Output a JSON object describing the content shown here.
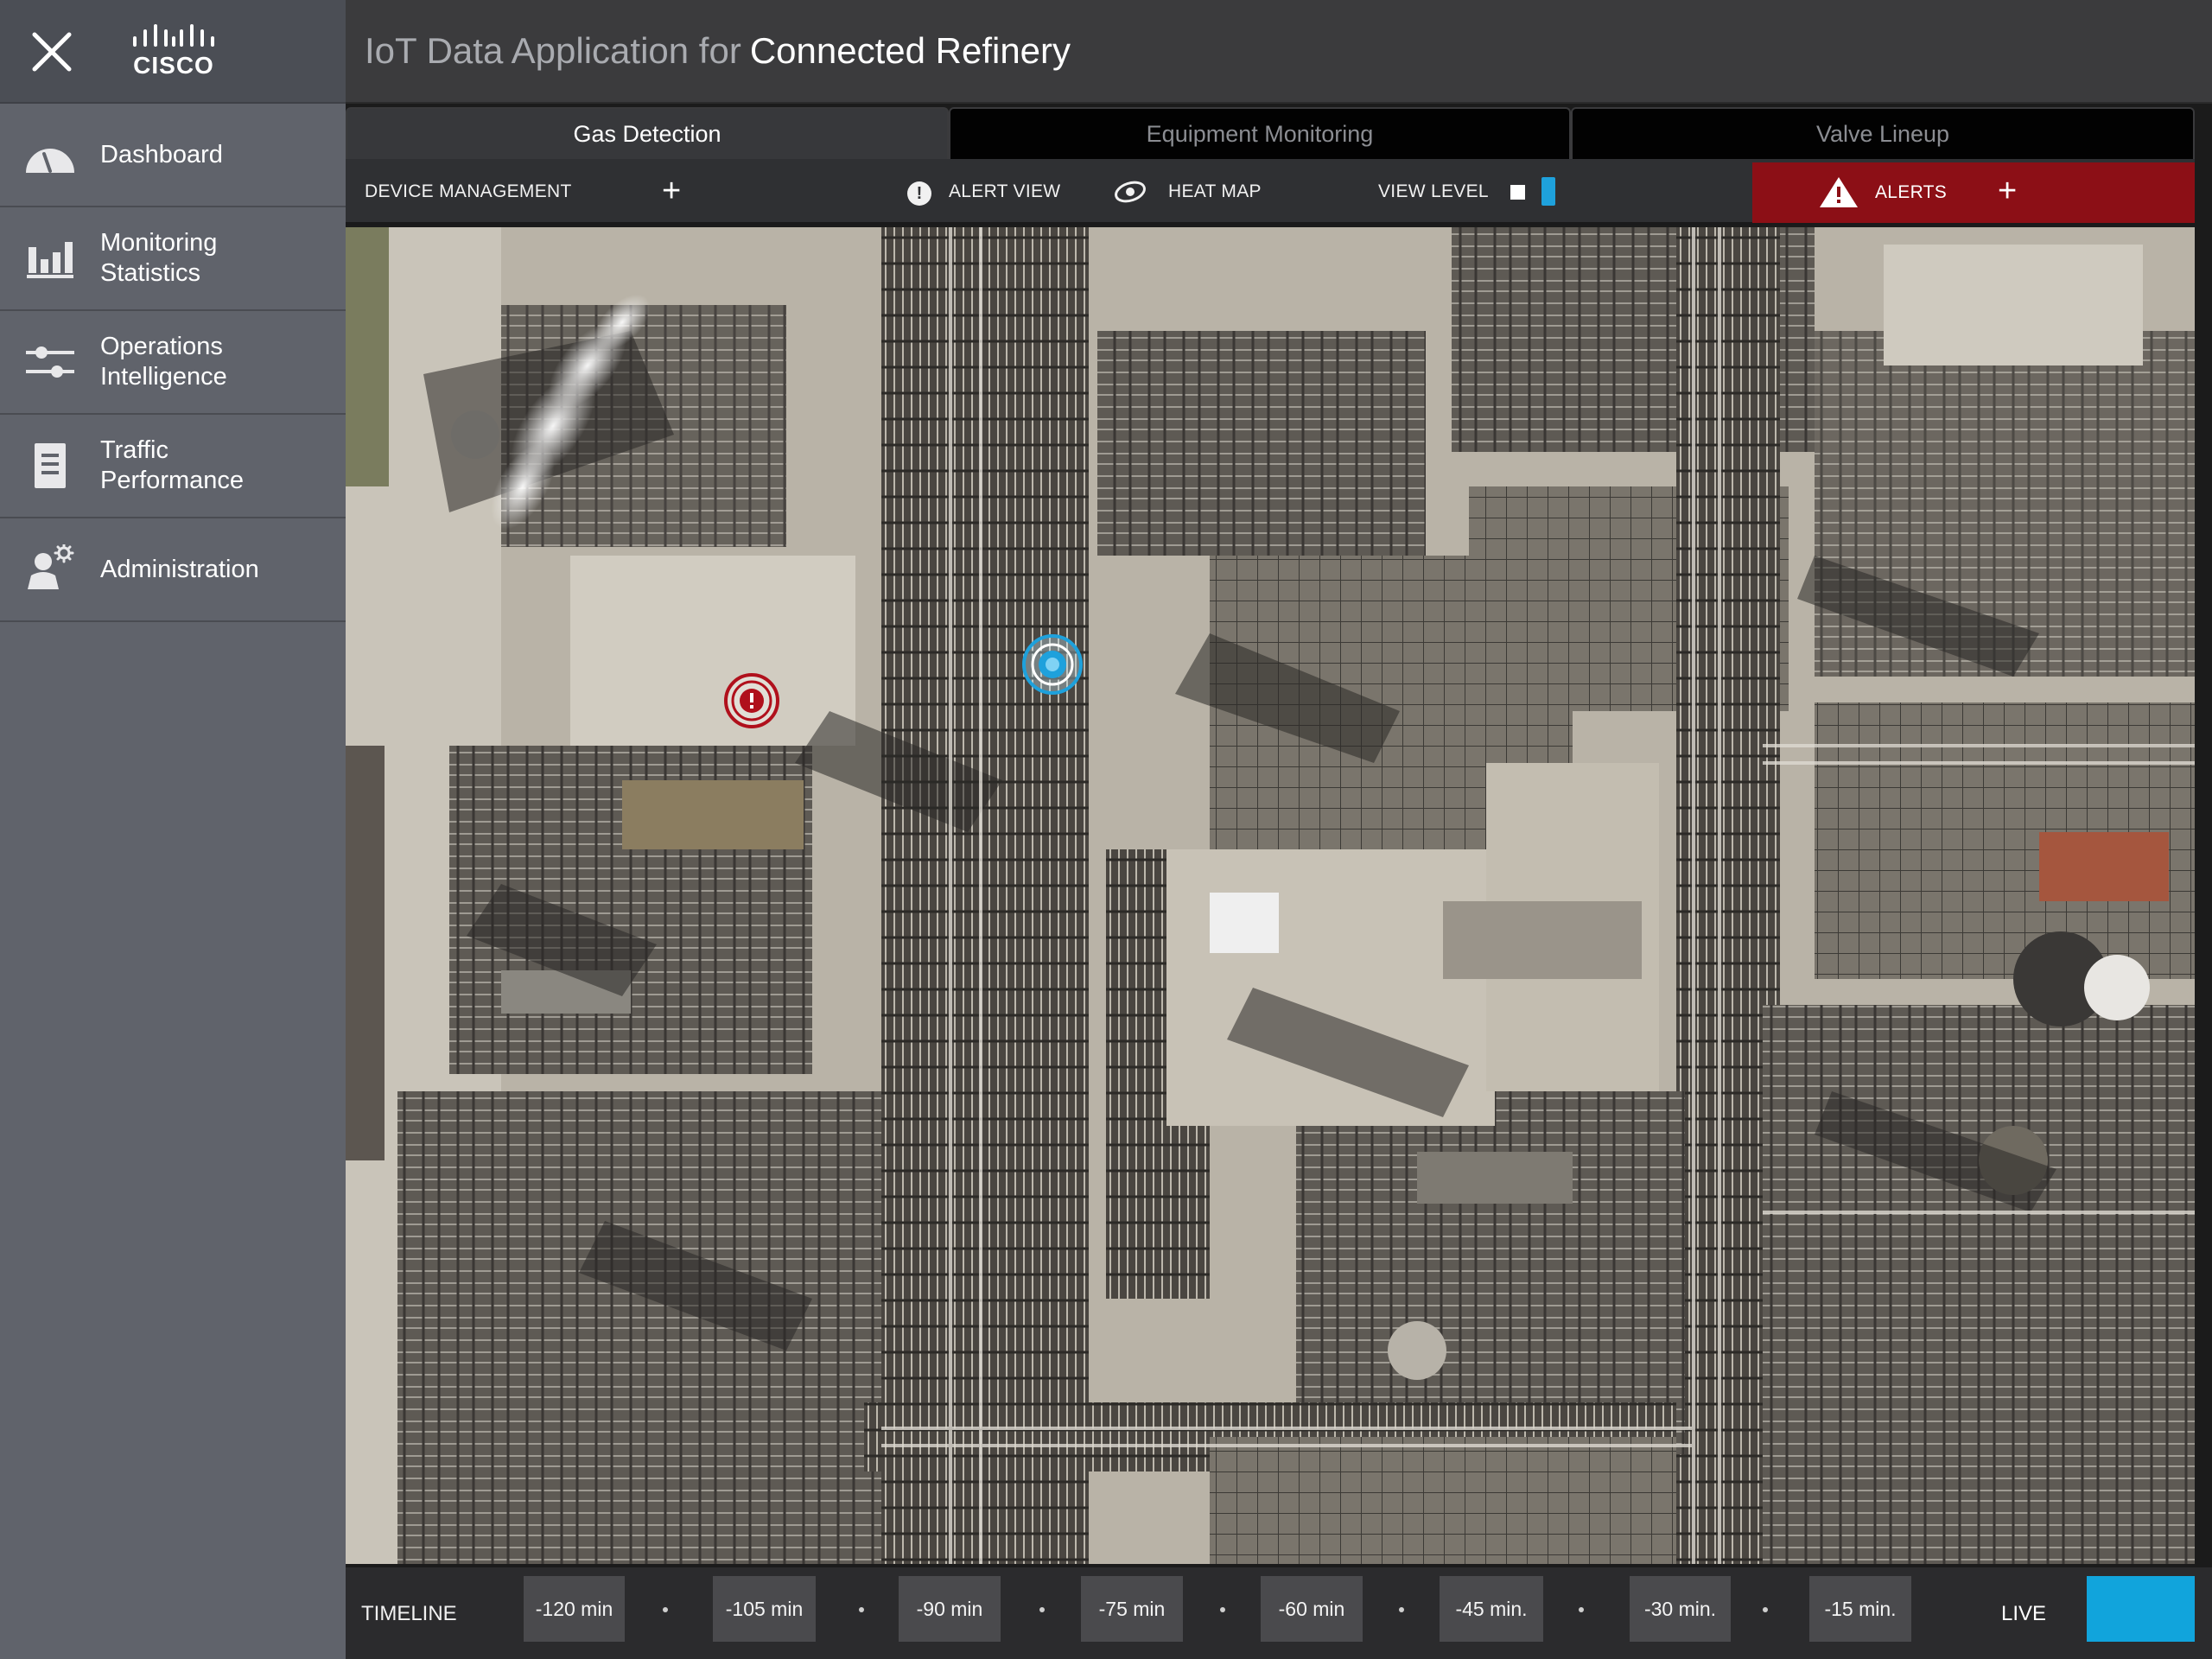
{
  "sidebar": {
    "logo_text": "CISCO",
    "items": [
      {
        "label": "Dashboard",
        "icon": "gauge-icon"
      },
      {
        "label": "Monitoring\nStatistics",
        "icon": "bar-chart-icon"
      },
      {
        "label": "Operations\nIntelligence",
        "icon": "sliders-icon"
      },
      {
        "label": "Traffic\nPerformance",
        "icon": "document-icon"
      },
      {
        "label": "Administration",
        "icon": "user-gear-icon"
      }
    ]
  },
  "header": {
    "title_prefix": "IoT Data Application for",
    "title_main": "Connected Refinery"
  },
  "tabs": [
    {
      "label": "Gas Detection",
      "active": true
    },
    {
      "label": "Equipment Monitoring",
      "active": false
    },
    {
      "label": "Valve Lineup",
      "active": false
    }
  ],
  "toolbar": {
    "device_management": "DEVICE MANAGEMENT",
    "alert_view": "ALERT VIEW",
    "alert_icon_glyph": "!",
    "heat_map": "HEAT MAP",
    "view_level": "VIEW LEVEL",
    "alerts": "ALERTS",
    "plus": "+"
  },
  "map": {
    "markers": [
      {
        "type": "alert",
        "glyph": "!",
        "color": "#b0101c"
      },
      {
        "type": "sensor",
        "color": "#1ea1dc"
      }
    ]
  },
  "timeline": {
    "label": "TIMELINE",
    "slots": [
      "-120 min",
      "-105 min",
      "-90 min",
      "-75 min",
      "-60 min",
      "-45 min.",
      "-30 min.",
      "-15 min."
    ],
    "live": "LIVE"
  },
  "colors": {
    "sidebar": "#60636b",
    "accent_blue": "#1ea1dc",
    "alert_red": "#8c0f16"
  }
}
